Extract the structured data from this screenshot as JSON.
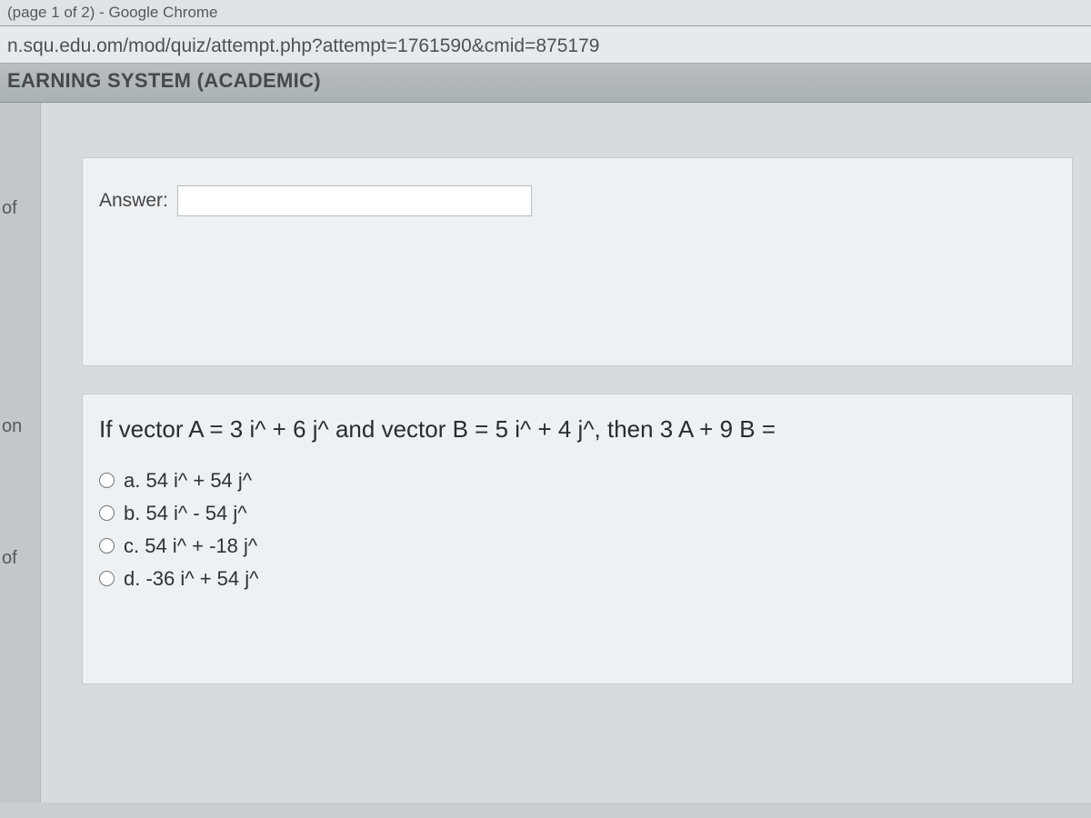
{
  "titlebar": {
    "text": "(page 1 of 2) - Google Chrome"
  },
  "urlbar": {
    "url": "n.squ.edu.om/mod/quiz/attempt.php?attempt=1761590&cmid=875179"
  },
  "site_banner": {
    "title": "EARNING SYSTEM (ACADEMIC)"
  },
  "left_nav": {
    "label1": "of",
    "label2": "on",
    "label3": "of"
  },
  "panel1": {
    "answer_label": "Answer:",
    "answer_value": ""
  },
  "panel2": {
    "question": "If vector A = 3 i^ + 6 j^ and vector B = 5 i^ + 4 j^, then  3 A + 9 B =",
    "options": {
      "a": "a. 54 i^ + 54 j^",
      "b": "b. 54 i^ - 54 j^",
      "c": "c. 54 i^ + -18 j^",
      "d": "d. -36 i^ + 54 j^"
    }
  }
}
